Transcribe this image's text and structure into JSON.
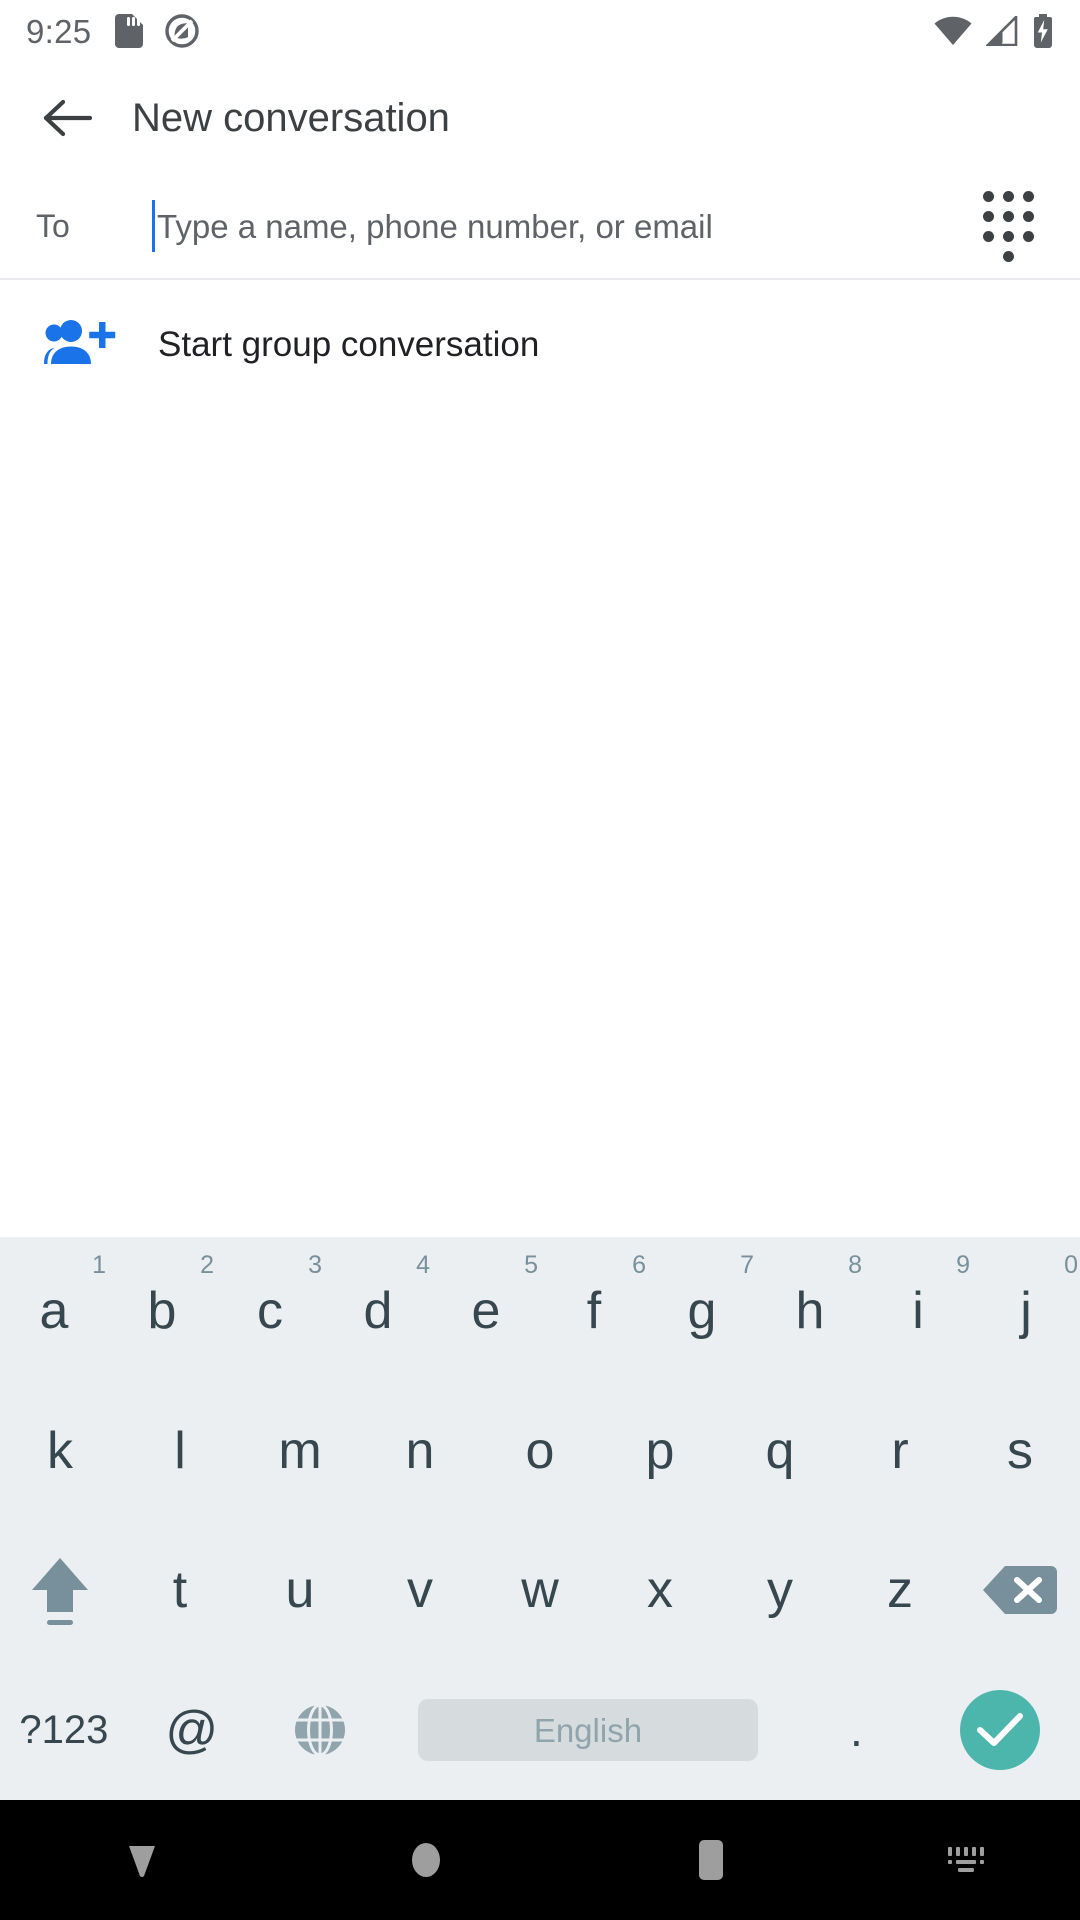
{
  "status_bar": {
    "time": "9:25",
    "icons": [
      "sd-card-icon",
      "do-not-disturb-icon",
      "wifi-icon",
      "cellular-signal-icon",
      "battery-charging-icon"
    ]
  },
  "app_bar": {
    "back_icon": "back-arrow-icon",
    "title": "New conversation"
  },
  "recipient_row": {
    "to_label": "To",
    "input_value": "",
    "placeholder": "Type a name, phone number, or email",
    "dialpad_icon": "dialpad-icon",
    "caret_color": "#1a73e8"
  },
  "suggestions": {
    "items": [
      {
        "icon": "group-add-icon",
        "label": "Start group conversation",
        "icon_color": "#1a73e8"
      }
    ]
  },
  "keyboard": {
    "language": "English",
    "accent_color": "#4db6ac",
    "background": "#eceff1",
    "rows": [
      {
        "name": "row-1",
        "keys": [
          {
            "label": "a",
            "hint": "1"
          },
          {
            "label": "b",
            "hint": "2"
          },
          {
            "label": "c",
            "hint": "3"
          },
          {
            "label": "d",
            "hint": "4"
          },
          {
            "label": "e",
            "hint": "5"
          },
          {
            "label": "f",
            "hint": "6"
          },
          {
            "label": "g",
            "hint": "7"
          },
          {
            "label": "h",
            "hint": "8"
          },
          {
            "label": "i",
            "hint": "9"
          },
          {
            "label": "j",
            "hint": "0"
          }
        ]
      },
      {
        "name": "row-2",
        "keys": [
          {
            "label": "k",
            "hint": ""
          },
          {
            "label": "l",
            "hint": ""
          },
          {
            "label": "m",
            "hint": ""
          },
          {
            "label": "n",
            "hint": ""
          },
          {
            "label": "o",
            "hint": ""
          },
          {
            "label": "p",
            "hint": ""
          },
          {
            "label": "q",
            "hint": ""
          },
          {
            "label": "r",
            "hint": ""
          },
          {
            "label": "s",
            "hint": ""
          }
        ]
      },
      {
        "name": "row-3",
        "keys": [
          {
            "label": "",
            "hint": "",
            "icon": "shift-icon"
          },
          {
            "label": "t",
            "hint": ""
          },
          {
            "label": "u",
            "hint": ""
          },
          {
            "label": "v",
            "hint": ""
          },
          {
            "label": "w",
            "hint": ""
          },
          {
            "label": "x",
            "hint": ""
          },
          {
            "label": "y",
            "hint": ""
          },
          {
            "label": "z",
            "hint": ""
          },
          {
            "label": "",
            "hint": "",
            "icon": "backspace-icon"
          }
        ]
      }
    ],
    "bottom_row": {
      "symbols_label": "?123",
      "at_label": "@",
      "globe_icon": "language-globe-icon",
      "space_label": "English",
      "period_label": ".",
      "enter_icon": "checkmark-icon"
    }
  },
  "nav_bar": {
    "buttons": [
      {
        "icon": "hide-keyboard-down-icon",
        "name": "back"
      },
      {
        "icon": "home-circle-icon",
        "name": "home"
      },
      {
        "icon": "recents-square-icon",
        "name": "recents"
      },
      {
        "icon": "keyboard-switch-icon",
        "name": "keyboard-switcher"
      }
    ]
  }
}
